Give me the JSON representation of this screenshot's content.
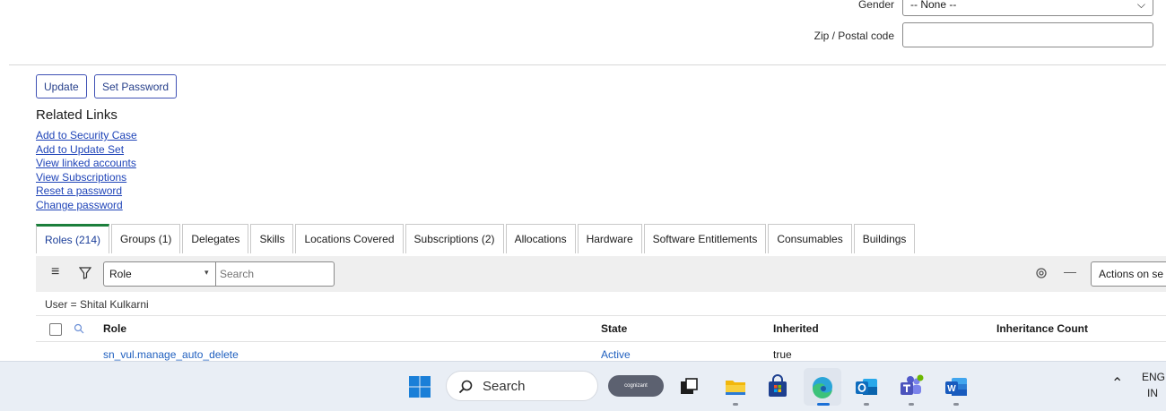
{
  "form": {
    "gender_label": "Gender",
    "gender_value": "-- None --",
    "zip_label": "Zip / Postal code",
    "zip_value": ""
  },
  "buttons": {
    "update": "Update",
    "set_password": "Set Password"
  },
  "related_links": {
    "title": "Related Links",
    "items": [
      "Add to Security Case",
      "Add to Update Set",
      "View linked accounts",
      "View Subscriptions",
      "Reset a password",
      "Change password"
    ]
  },
  "tabs": [
    "Roles (214)",
    "Groups (1)",
    "Delegates",
    "Skills",
    "Locations Covered",
    "Subscriptions (2)",
    "Allocations",
    "Hardware",
    "Software Entitlements",
    "Consumables",
    "Buildings"
  ],
  "list": {
    "search_field": "Role",
    "search_placeholder": "Search",
    "actions_label": "Actions on se",
    "filter": "User = Shital Kulkarni",
    "columns": [
      "Role",
      "State",
      "Inherited",
      "Inheritance Count"
    ],
    "rows": [
      {
        "role": "sn_vul.manage_auto_delete",
        "state": "Active",
        "inherited": "true",
        "count": ""
      }
    ]
  },
  "taskbar": {
    "search_label": "Search",
    "badge_text": "cognizant",
    "lang_top": "ENG",
    "lang_bottom": "IN"
  },
  "colors": {
    "accent": "#1b7f3b",
    "link": "#1f44b8",
    "button_border": "#3f51b5"
  }
}
